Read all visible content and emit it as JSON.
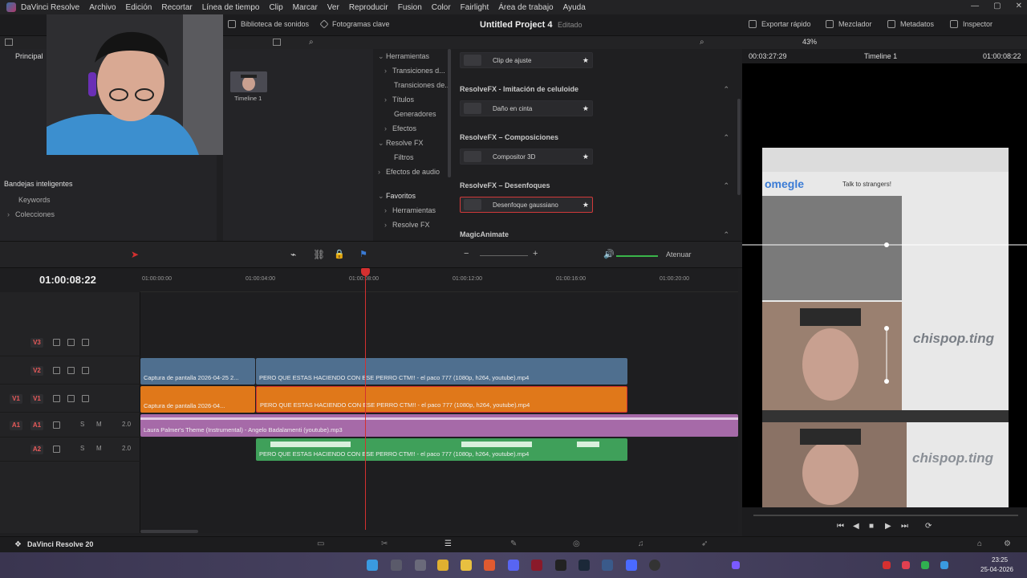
{
  "menubar": {
    "app_name": "DaVinci Resolve",
    "items": [
      "Archivo",
      "Edición",
      "Recortar",
      "Línea de tiempo",
      "Clip",
      "Marcar",
      "Ver",
      "Reproducir",
      "Fusion",
      "Color",
      "Fairlight",
      "Área de trabajo",
      "Ayuda"
    ]
  },
  "toolbar": {
    "sound_library": "Biblioteca de sonidos",
    "keyframes": "Fotogramas clave",
    "project_title": "Untitled Project 4",
    "project_status": "Editado",
    "quick_export": "Exportar rápido",
    "mixer": "Mezclador",
    "metadata": "Metadatos",
    "inspector": "Inspector"
  },
  "left_panel": {
    "principal": "Principal",
    "smart_bins": "Bandejas inteligentes",
    "keywords": "Keywords",
    "collections": "Colecciones"
  },
  "media_pool": {
    "thumb_label": "Timeline 1"
  },
  "effects_tree": [
    {
      "label": "Herramientas",
      "expanded": true,
      "level": 0
    },
    {
      "label": "Transiciones d...",
      "expanded": false,
      "level": 1
    },
    {
      "label": "Transiciones de...",
      "expanded": null,
      "level": 1
    },
    {
      "label": "Títulos",
      "expanded": false,
      "level": 1
    },
    {
      "label": "Generadores",
      "expanded": null,
      "level": 1
    },
    {
      "label": "Efectos",
      "expanded": false,
      "level": 1
    },
    {
      "label": "Resolve FX",
      "expanded": true,
      "level": 0
    },
    {
      "label": "Filtros",
      "expanded": null,
      "level": 1
    },
    {
      "label": "Efectos de audio",
      "expanded": true,
      "level": 0
    },
    {
      "label": "Favoritos",
      "expanded": true,
      "level": 0,
      "selected": true
    },
    {
      "label": "Herramientas",
      "expanded": false,
      "level": 1
    },
    {
      "label": "Resolve FX",
      "expanded": false,
      "level": 1
    }
  ],
  "effects_list": {
    "adjust_clip": "Clip de ajuste",
    "sections": [
      {
        "title": "ResolveFX - Imitación de celuloide",
        "item": "Daño en cinta",
        "active": false
      },
      {
        "title": "ResolveFX – Composiciones",
        "item": "Compositor 3D",
        "active": false
      },
      {
        "title": "ResolveFX – Desenfoques",
        "item": "Desenfoque gaussiano",
        "active": true
      }
    ],
    "last_section": "MagicAnimate"
  },
  "viewer": {
    "zoom": "43%",
    "timecode_left": "00:03:27:29",
    "timeline_name": "Timeline 1",
    "timecode_right": "01:00:08:22",
    "watermark_text": "chispop.ting",
    "site_name": "omegle",
    "site_tagline": "Talk to strangers!"
  },
  "timeline": {
    "timecode": "01:00:08:22",
    "ruler": [
      "01:00:00:00",
      "01:00:04:00",
      "01:00:08:00",
      "01:00:12:00",
      "01:00:16:00",
      "01:00:20:00"
    ],
    "attenuate": "Atenuar",
    "tracks": [
      {
        "side": "",
        "id": "V3"
      },
      {
        "side": "",
        "id": "V2"
      },
      {
        "side": "V1",
        "id": "V1"
      },
      {
        "side": "A1",
        "id": "A1",
        "solo": "S",
        "mute": "M",
        "level": "2.0"
      },
      {
        "side": "",
        "id": "A2",
        "solo": "S",
        "mute": "M",
        "level": "2.0"
      }
    ],
    "clips": {
      "v2_a": "Captura de pantalla 2026-04-25 2...",
      "v2_b": "PERO QUE ESTAS HACIENDO CON ESE PERRO CTM!! - el paco 777 (1080p, h264, youtube).mp4",
      "v1_a": "Captura de pantalla 2026-04...",
      "v1_b": "PERO QUE ESTAS HACIENDO CON ESE PERRO CTM!! - el paco 777 (1080p, h264, youtube).mp4",
      "a1": "Laura Palmer's Theme (Instrumental) - Angelo Badalamenti (youtube).mp3",
      "a2": "PERO QUE ESTAS HACIENDO CON ESE PERRO CTM!! - el paco 777 (1080p, h264, youtube).mp4"
    }
  },
  "footer": {
    "brand": "DaVinci Resolve 20"
  },
  "taskbar": {
    "time": "23:25",
    "date": "25-04-2026"
  },
  "colors": {
    "accent": "#d43030",
    "video_blue": "#4f6f8f",
    "video_orange": "#e0781a",
    "audio_purple": "#a66aa8",
    "audio_green": "#3fa05a"
  }
}
